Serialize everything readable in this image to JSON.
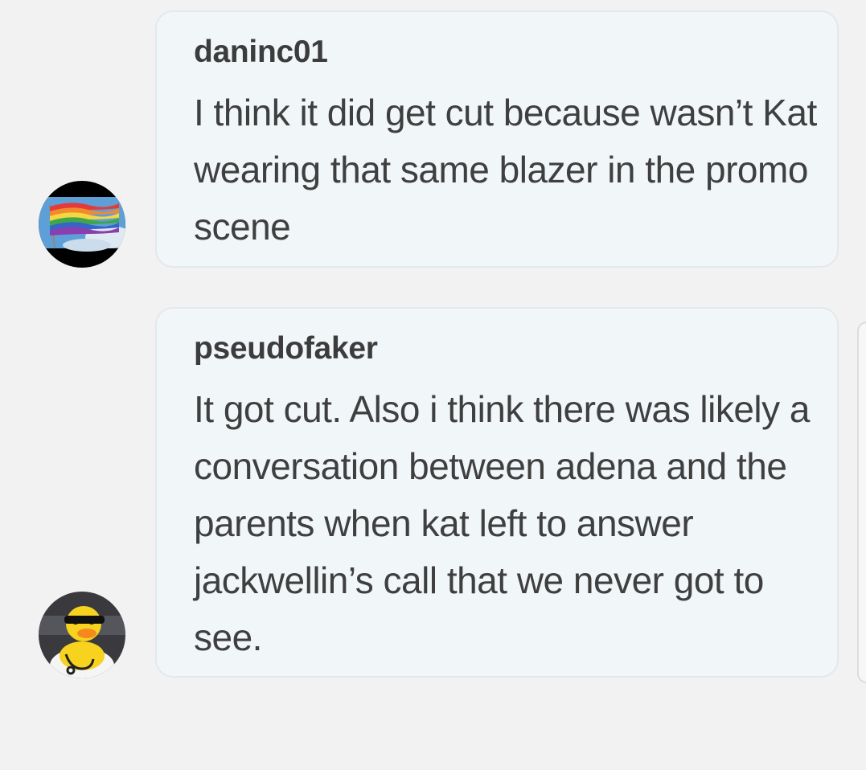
{
  "messages": [
    {
      "username": "daninc01",
      "avatar_icon": "rainbow-flag-avatar-icon",
      "text": "I think it did get cut because wasn’t Kat wearing that same blazer in the promo scene"
    },
    {
      "username": "pseudofaker",
      "avatar_icon": "rubber-duck-avatar-icon",
      "text": "It got cut. Also i think there was likely a conversation between adena and the parents when kat left to answer jackwellin’s call that we never got to see."
    }
  ],
  "colors": {
    "background": "#f2f2f2",
    "bubble": "#f1f6f9",
    "bubble_border": "#e3e8ec",
    "username": "#3c3c3c",
    "text": "#3f3f3f"
  }
}
